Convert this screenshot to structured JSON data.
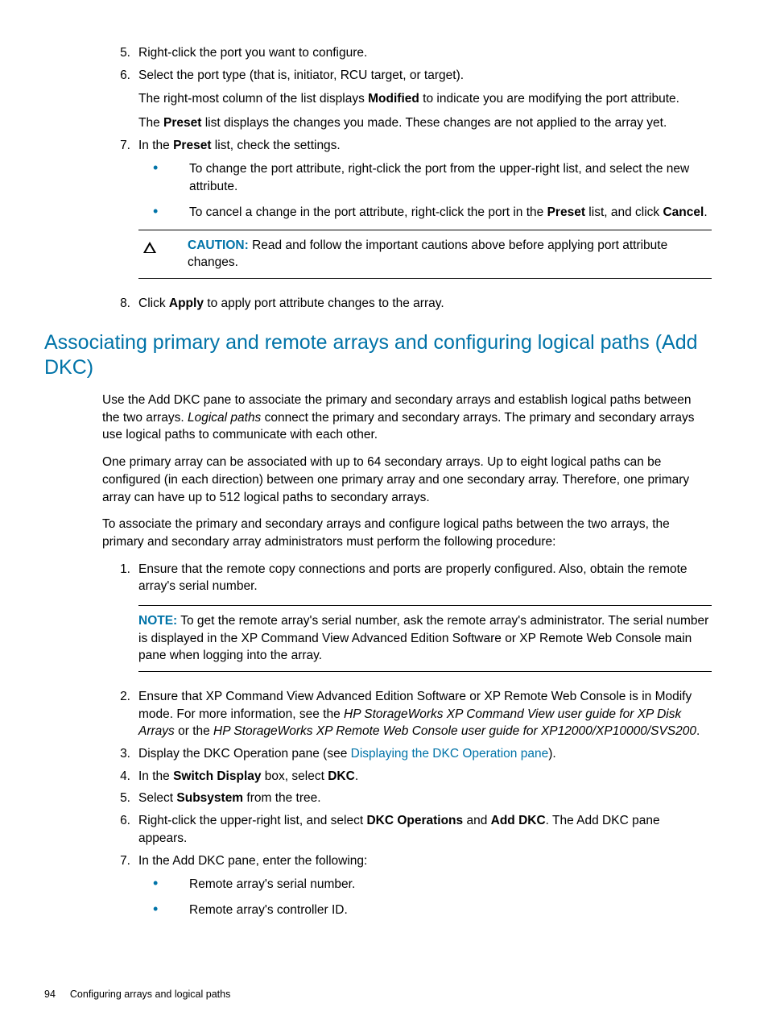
{
  "steps_a": {
    "s5": {
      "num": "5.",
      "text": "Right-click the port you want to configure."
    },
    "s6": {
      "num": "6.",
      "p1_a": "Select the port type (that is, initiator, RCU target, or target).",
      "p2_a": "The right-most column of the list displays ",
      "p2_bold": "Modified",
      "p2_b": " to indicate you are modifying the port attribute.",
      "p3_a": "The ",
      "p3_bold": "Preset",
      "p3_b": " list displays the changes you made. These changes are not applied to the array yet."
    },
    "s7": {
      "num": "7.",
      "p1_a": "In the ",
      "p1_bold": "Preset",
      "p1_b": " list, check the settings.",
      "b1": "To change the port attribute, right-click the port from the upper-right list, and select the new attribute.",
      "b2_a": "To cancel a change in the port attribute, right-click the port in the ",
      "b2_bold1": "Preset",
      "b2_b": " list, and click ",
      "b2_bold2": "Cancel",
      "b2_c": ".",
      "caution_label": "CAUTION:",
      "caution_text": " Read and follow the important cautions above before applying port attribute changes."
    },
    "s8": {
      "num": "8.",
      "a": "Click ",
      "bold": "Apply",
      "b": " to apply port attribute changes to the array."
    }
  },
  "heading": "Associating primary and remote arrays and configuring logical paths (Add DKC)",
  "para1_a": "Use the Add DKC pane to associate the primary and secondary arrays and establish logical paths between the two arrays. ",
  "para1_italic": "Logical paths",
  "para1_b": " connect the primary and secondary arrays. The primary and secondary arrays use logical paths to communicate with each other.",
  "para2": "One primary array can be associated with up to 64 secondary arrays. Up to eight logical paths can be configured (in each direction) between one primary array and one secondary array. Therefore, one primary array can have up to 512 logical paths to secondary arrays.",
  "para3": "To associate the primary and secondary arrays and configure logical paths between the two arrays, the primary and secondary array administrators must perform the following procedure:",
  "steps_b": {
    "s1": {
      "num": "1.",
      "p1": "Ensure that the remote copy connections and ports are properly configured. Also, obtain the remote array's serial number.",
      "note_label": "NOTE:",
      "note_text": " To get the remote array's serial number, ask the remote array's administrator. The serial number is displayed in the XP Command View Advanced Edition Software or XP Remote Web Console main pane when logging into the array."
    },
    "s2": {
      "num": "2.",
      "a": "Ensure that XP Command View Advanced Edition Software or XP Remote Web Console is in Modify mode. For more information, see the ",
      "i1": "HP StorageWorks XP Command View user guide for XP Disk Arrays",
      "b": " or the ",
      "i2": "HP StorageWorks XP Remote Web Console user guide for XP12000/XP10000/SVS200",
      "c": "."
    },
    "s3": {
      "num": "3.",
      "a": "Display the DKC Operation pane (see ",
      "link": "Displaying the DKC Operation pane",
      "b": ")."
    },
    "s4": {
      "num": "4.",
      "a": "In the ",
      "bold1": "Switch Display",
      "b": " box, select ",
      "bold2": "DKC",
      "c": "."
    },
    "s5": {
      "num": "5.",
      "a": "Select ",
      "bold": "Subsystem",
      "b": " from the tree."
    },
    "s6": {
      "num": "6.",
      "a": "Right-click the upper-right list, and select ",
      "bold1": "DKC Operations",
      "b": " and ",
      "bold2": "Add DKC",
      "c": ". The Add DKC pane appears."
    },
    "s7": {
      "num": "7.",
      "p1": "In the Add DKC pane, enter the following:",
      "b1": "Remote array's serial number.",
      "b2": "Remote array's controller ID."
    }
  },
  "footer": {
    "page": "94",
    "chapter": "Configuring arrays and logical paths"
  }
}
